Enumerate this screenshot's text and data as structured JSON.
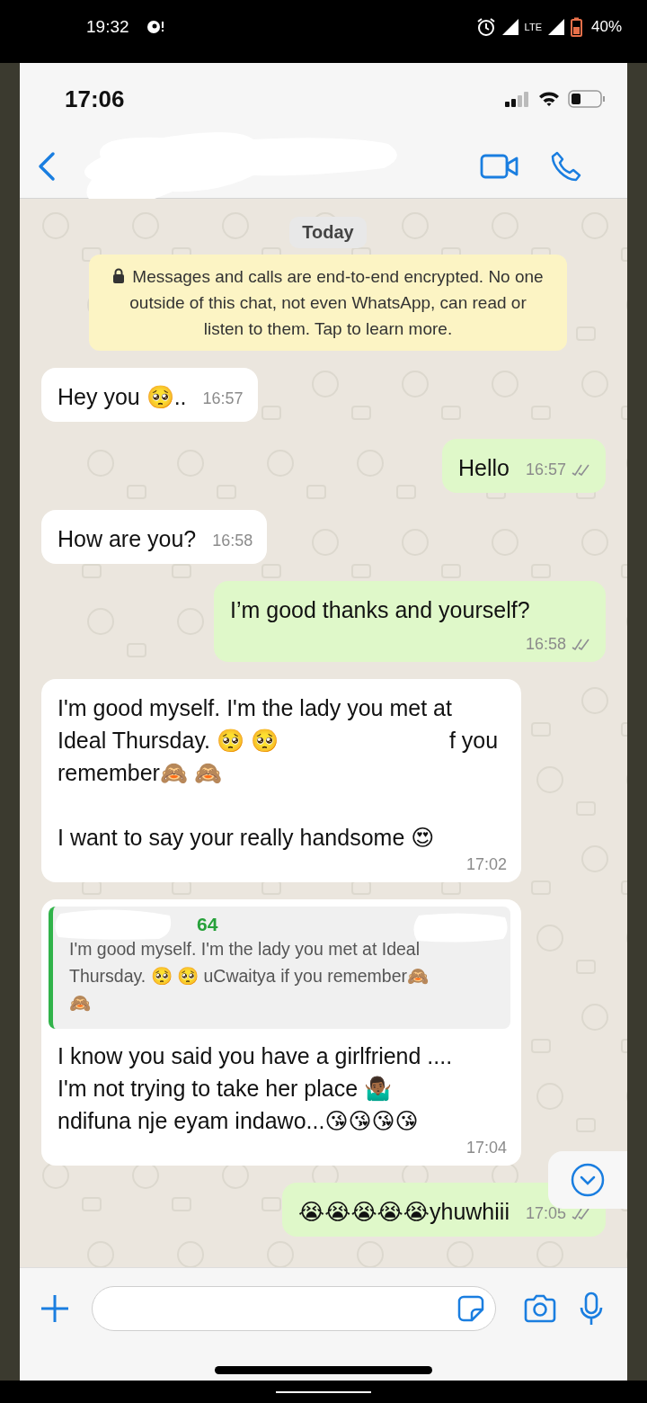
{
  "phone_status": {
    "time": "19:32",
    "battery": "40%",
    "network": "LTE"
  },
  "chat": {
    "time": "17:06",
    "contact_redacted": true,
    "date_chip": "Today",
    "encryption_notice": "Messages and calls are end-to-end encrypted. No one outside of this chat, not even WhatsApp, can read or listen to them. Tap to learn more.",
    "messages": [
      {
        "outgoing": false,
        "lines": [
          [
            {
              "kind": "text",
              "text": "Hey you 🥺.."
            }
          ]
        ],
        "time": "16:57"
      },
      {
        "outgoing": true,
        "lines": [
          [
            {
              "kind": "text",
              "text": "Hello"
            }
          ]
        ],
        "time": "16:57",
        "read": false
      },
      {
        "outgoing": false,
        "lines": [
          [
            {
              "kind": "text",
              "text": "How are you?"
            }
          ]
        ],
        "time": "16:58"
      },
      {
        "outgoing": true,
        "lines": [
          [
            {
              "kind": "text",
              "text": "I’m good thanks and yourself?"
            }
          ]
        ],
        "time": "16:58",
        "read": false
      },
      {
        "outgoing": false,
        "lines": [
          [
            {
              "kind": "text",
              "text": "I'm good myself. I'm the lady you met at"
            }
          ],
          [
            {
              "kind": "text",
              "text": "Ideal Thursday. 🥺 🥺"
            },
            {
              "kind": "redacted"
            },
            {
              "kind": "text",
              "text": "f you"
            }
          ],
          [
            {
              "kind": "text",
              "text": "remember🙈 🙈"
            }
          ],
          [
            {
              "kind": "blank"
            }
          ],
          [
            {
              "kind": "text",
              "text": "I want to say your really handsome 😍"
            }
          ]
        ],
        "time": "17:02"
      },
      {
        "outgoing": false,
        "quote": {
          "author": "64",
          "text": "I'm good myself. I'm the lady you met at Ideal\nThursday. 🥺 🥺 uCwaitya if you remember🙈\n🙈",
          "redacted": true
        },
        "lines": [
          [
            {
              "kind": "text",
              "text": "I know you said you have a girlfriend ...."
            }
          ],
          [
            {
              "kind": "text",
              "text": "I'm not trying to take her place 🤷🏾‍♂️"
            }
          ],
          [
            {
              "kind": "text",
              "text": "ndifuna nje eyam indawo...😘😘😘😘"
            }
          ]
        ],
        "time": "17:04"
      },
      {
        "outgoing": true,
        "lines": [
          [
            {
              "kind": "text",
              "text": "😭😭😭😭😭yhuwhiii"
            }
          ]
        ],
        "time": "17:05",
        "read": false
      }
    ]
  }
}
